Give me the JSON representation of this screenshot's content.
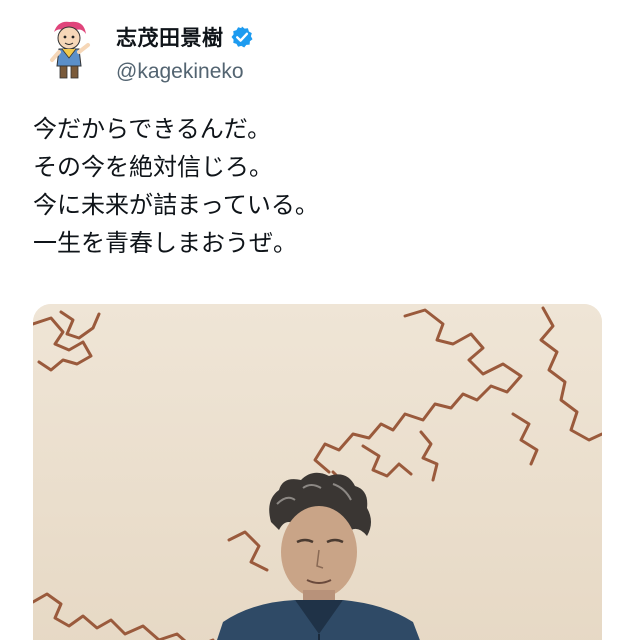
{
  "author": {
    "display_name": "志茂田景樹",
    "handle": "@kagekineko",
    "verified": true,
    "avatar_icon": "cartoon-avatar-icon",
    "verified_icon": "verified-badge-icon"
  },
  "tweet": {
    "lines": [
      "今だからできるんだ。",
      "その今を絶対信じろ。",
      "今に未来が詰まっている。",
      "一生を青春しまおうぜ。"
    ]
  },
  "media": {
    "type": "photo"
  },
  "colors": {
    "text": "#0f1419",
    "secondary_text": "#536471",
    "verified_blue": "#1d9bf0"
  }
}
